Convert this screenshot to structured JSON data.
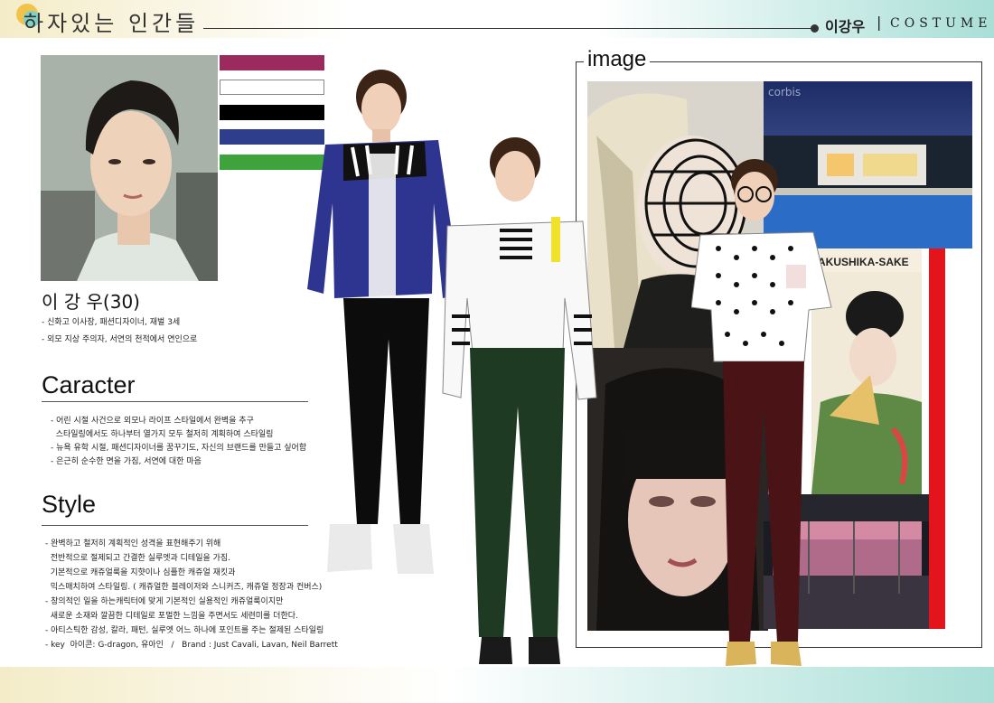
{
  "header": {
    "logo_text": "하자있는 인간들",
    "character_name": "이강우",
    "separator": "|",
    "label": "COSTUME"
  },
  "profile": {
    "name": "이 강 우(30)",
    "details": [
      "- 신화고 이사장, 패션디자이너, 재벌 3세",
      "- 외모 지상 주의자, 서연의 천적에서 연인으로"
    ]
  },
  "palette": {
    "colors": [
      "#9b2a5e",
      "#ffffff",
      "#000000",
      "#2e3e8c",
      "#3ea33b"
    ]
  },
  "character": {
    "title": "Caracter",
    "lines": [
      "- 어린 시절 사건으로 외모나 라이프 스타일에서 완벽을 추구",
      "  스타일링에서도 하나부터 열가지 모두 철저히 계획하여 스타일링",
      "- 뉴욕 유학 시절, 패션디자이너를 꿈꾸기도, 자신의 브랜드를 만들고 싶어함",
      "- 은근히 순수한 면을 가짐, 서연에 대한 마음"
    ]
  },
  "style": {
    "title": "Style",
    "lines": [
      "- 완벽하고 철저히 계획적인 성격을 표현해주기 위해",
      "  전반적으로 절제되고 간결한 실루엣과 디테일을 가짐.",
      "  기본적으로 캐쥬얼룩을 지햣이나 심플한 캐쥬얼 재킷과",
      "  믹스매치하여 스타일링. ( 캐쥬얼한 블레이저와 스니커즈, 캐쥬얼 정장과 컨버스)",
      "- 창의적인 일을 하는캐릭터에 맞게 기본적인 실용적인 캐쥬얼룩이지만",
      "  새로운 소재와 깔끔한 디테일로 포멀한 느낌을 주면서도 세련미를 더한다.",
      "- 아티스틱한 감성, 칼라, 패턴, 실루엣 어느 하나에 포인트를 주는 절제된 스타일링",
      "- key  아이콘: G-dragon, 유아인   /   Brand : Just Cavali, Lavan, Neil Barrett"
    ]
  },
  "image_board": {
    "title": "image",
    "watermark": "corbis",
    "poster_text": "AKUSHIKA-SAKE"
  }
}
